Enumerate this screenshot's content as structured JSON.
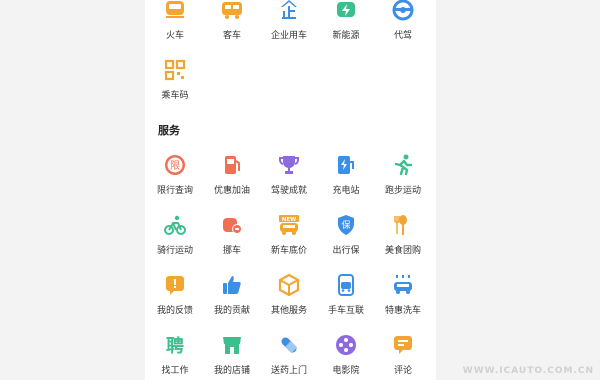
{
  "top_items": [
    {
      "label": "火车",
      "icon": "train-icon",
      "color": "#f2a531"
    },
    {
      "label": "客车",
      "icon": "bus-icon",
      "color": "#f2a531"
    },
    {
      "label": "企业用车",
      "icon": "enterprise-icon",
      "color": "#3d8fe6"
    },
    {
      "label": "新能源",
      "icon": "new-energy-icon",
      "color": "#3cbf8c"
    },
    {
      "label": "代驾",
      "icon": "steering-wheel-icon",
      "color": "#3d8fe6"
    },
    {
      "label": "乘车码",
      "icon": "qr-code-icon",
      "color": "#f2a531"
    }
  ],
  "services": {
    "title": "服务",
    "items": [
      {
        "label": "限行查询",
        "icon": "restriction-icon",
        "color": "#f06f55"
      },
      {
        "label": "优惠加油",
        "icon": "fuel-pump-icon",
        "color": "#f06f55"
      },
      {
        "label": "驾驶成就",
        "icon": "trophy-icon",
        "color": "#8d6ae0"
      },
      {
        "label": "充电站",
        "icon": "charging-station-icon",
        "color": "#3d8fe6"
      },
      {
        "label": "跑步运动",
        "icon": "running-icon",
        "color": "#3cbf8c"
      },
      {
        "label": "骑行运动",
        "icon": "cycling-icon",
        "color": "#3cbf8c"
      },
      {
        "label": "挪车",
        "icon": "move-car-icon",
        "color": "#f06f55"
      },
      {
        "label": "新车底价",
        "icon": "new-car-price-icon",
        "color": "#f2a531"
      },
      {
        "label": "出行保",
        "icon": "insurance-icon",
        "color": "#3d8fe6"
      },
      {
        "label": "美食团购",
        "icon": "food-icon",
        "color": "#f2a531"
      },
      {
        "label": "我的反馈",
        "icon": "feedback-icon",
        "color": "#f2a531"
      },
      {
        "label": "我的贡献",
        "icon": "thumbs-up-icon",
        "color": "#3d8fe6"
      },
      {
        "label": "其他服务",
        "icon": "other-services-icon",
        "color": "#f2a531"
      },
      {
        "label": "手车互联",
        "icon": "phone-car-icon",
        "color": "#3d8fe6"
      },
      {
        "label": "特惠洗车",
        "icon": "car-wash-icon",
        "color": "#3d8fe6"
      },
      {
        "label": "找工作",
        "icon": "job-icon",
        "color": "#3cbf8c"
      },
      {
        "label": "我的店铺",
        "icon": "store-icon",
        "color": "#3cbf8c"
      },
      {
        "label": "送药上门",
        "icon": "medicine-icon",
        "color": "#3d8fe6"
      },
      {
        "label": "电影院",
        "icon": "film-icon",
        "color": "#8d6ae0"
      },
      {
        "label": "评论",
        "icon": "comment-icon",
        "color": "#f2a531"
      }
    ]
  },
  "watermark": "WWW.ICAUTO.COM.CN"
}
